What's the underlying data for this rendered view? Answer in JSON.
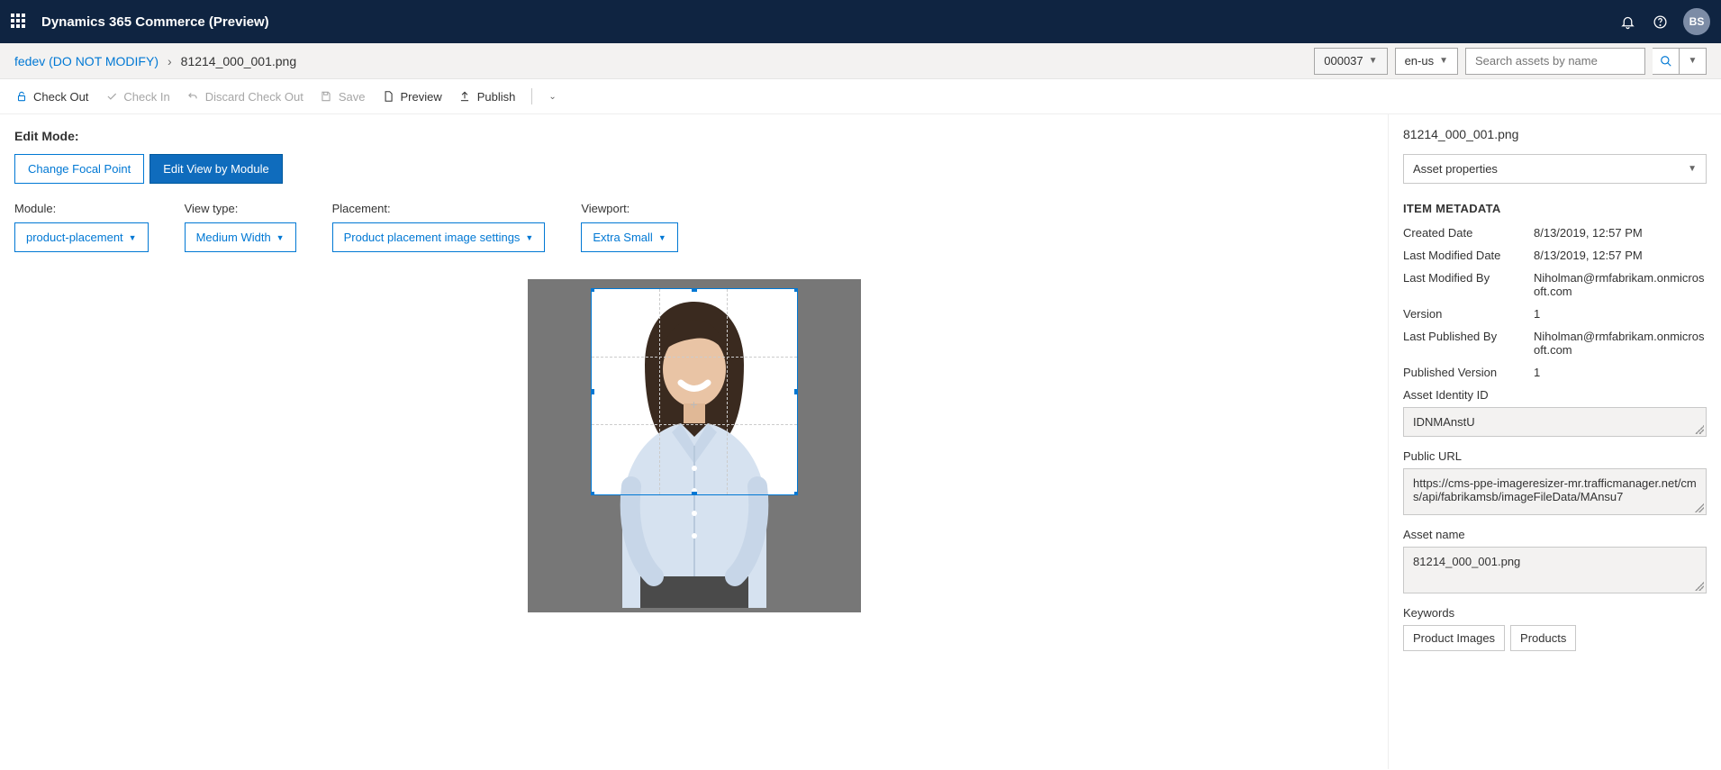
{
  "header": {
    "app_title": "Dynamics 365 Commerce (Preview)",
    "avatar_initials": "BS"
  },
  "breadcrumb": {
    "root": "fedev (DO NOT MODIFY)",
    "current": "81214_000_001.png"
  },
  "context_selectors": {
    "tenant": "000037",
    "locale": "en-us"
  },
  "search": {
    "placeholder": "Search assets by name"
  },
  "commands": {
    "check_out": "Check Out",
    "check_in": "Check In",
    "discard": "Discard Check Out",
    "save": "Save",
    "preview": "Preview",
    "publish": "Publish"
  },
  "edit_mode": {
    "label": "Edit Mode:",
    "change_focal": "Change Focal Point",
    "edit_view": "Edit View by Module"
  },
  "options": {
    "module_label": "Module:",
    "module_value": "product-placement",
    "viewtype_label": "View type:",
    "viewtype_value": "Medium Width",
    "placement_label": "Placement:",
    "placement_value": "Product placement image settings",
    "viewport_label": "Viewport:",
    "viewport_value": "Extra Small"
  },
  "side": {
    "asset_filename": "81214_000_001.png",
    "properties_dropdown": "Asset properties",
    "metadata_heading": "ITEM METADATA",
    "metadata": {
      "created_label": "Created Date",
      "created_value": "8/13/2019, 12:57 PM",
      "modified_label": "Last Modified Date",
      "modified_value": "8/13/2019, 12:57 PM",
      "modified_by_label": "Last Modified By",
      "modified_by_value": "Niholman@rmfabrikam.onmicrosoft.com",
      "version_label": "Version",
      "version_value": "1",
      "published_by_label": "Last Published By",
      "published_by_value": "Niholman@rmfabrikam.onmicrosoft.com",
      "published_version_label": "Published Version",
      "published_version_value": "1"
    },
    "asset_id_label": "Asset Identity ID",
    "asset_id_value": "IDNMAnstU",
    "public_url_label": "Public URL",
    "public_url_value": "https://cms-ppe-imageresizer-mr.trafficmanager.net/cms/api/fabrikamsb/imageFileData/MAnsu7",
    "asset_name_label": "Asset name",
    "asset_name_value": "81214_000_001.png",
    "keywords_label": "Keywords",
    "keywords": [
      "Product Images",
      "Products"
    ]
  }
}
